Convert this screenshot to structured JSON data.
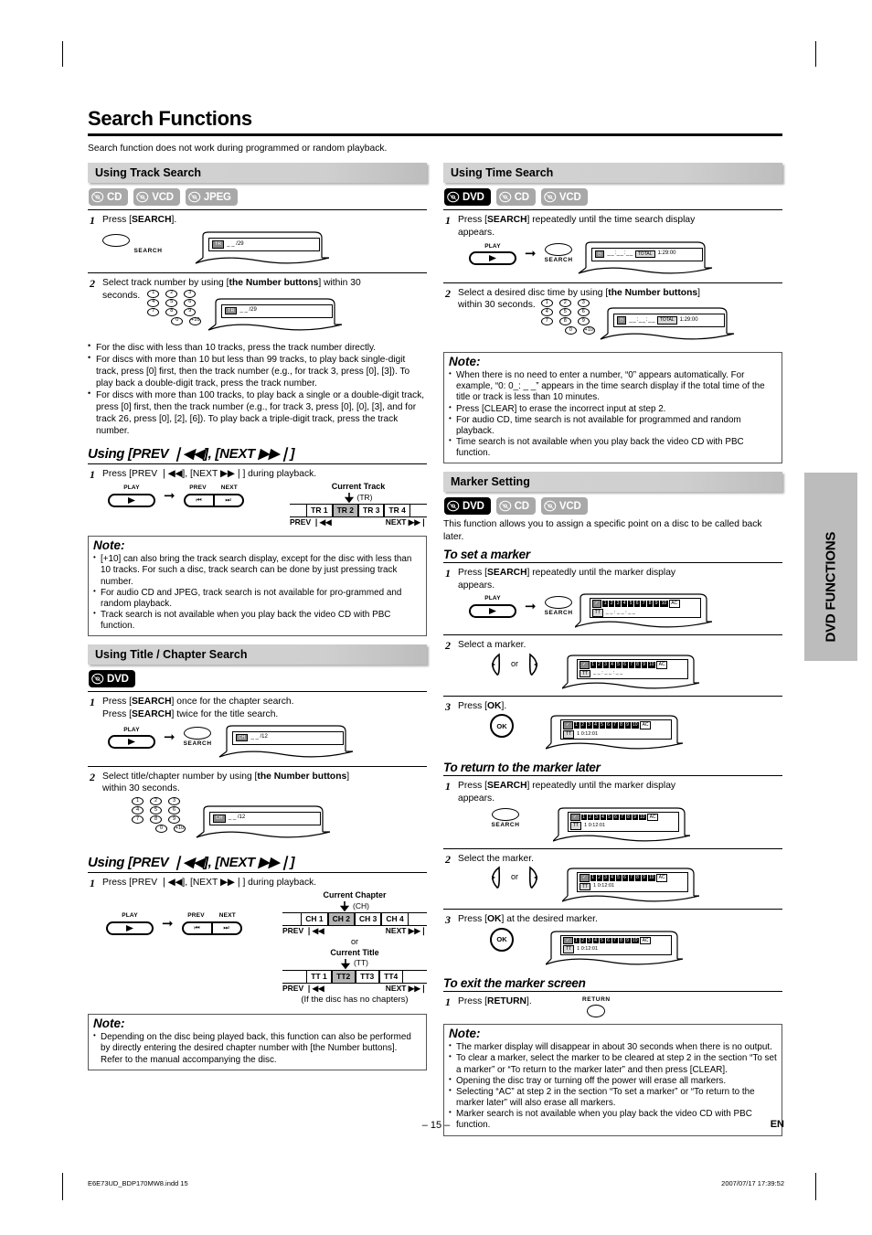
{
  "page": {
    "title": "Search Functions",
    "intro": "Search function does not work during programmed or random playback.",
    "number": "– 15 –",
    "lang_mark": "EN",
    "side_tab": "DVD FUNCTIONS"
  },
  "footer": {
    "file": "E6E73UD_BDP170MW8.indd   15",
    "stamp": "2007/07/17   17:39:52"
  },
  "track_search": {
    "heading": "Using Track Search",
    "badges": [
      {
        "label": "CD",
        "dark": false
      },
      {
        "label": "VCD",
        "dark": false
      },
      {
        "label": "JPEG",
        "dark": false
      }
    ],
    "step1": {
      "num": "1",
      "text_a": "Press [",
      "bold": "SEARCH",
      "text_b": "]."
    },
    "step1_key": {
      "label": "SEARCH"
    },
    "step1_display": {
      "tag": "TR",
      "value": "_ _ /29"
    },
    "step2": {
      "num": "2",
      "line1": "Select track number by using [",
      "bold": "the Number buttons",
      "line1b": "] within 30",
      "line2": "seconds."
    },
    "step2_display": {
      "tag": "TR",
      "value": "_ _ /29"
    },
    "bullets": [
      "For the disc with less than 10 tracks, press the track number directly.",
      "For discs with more than 10 but less than 99 tracks, to play back single-digit track, press [0] first, then the track number (e.g., for track 3, press [0], [3]). To play back a double-digit track, press the track number.",
      "For discs with more than 100 tracks, to play back a single or a double-digit track, press [0] first, then the track number (e.g., for track 3, press [0], [0], [3], and for track 26, press [0], [2], [6]). To play back a triple-digit track, press the track number."
    ]
  },
  "track_prevnext": {
    "heading": "Using [PREV ❘◀◀], [NEXT ▶▶❘]",
    "step1": {
      "num": "1",
      "text": "Press [PREV ❘◀◀], [NEXT ▶▶❘] during playback."
    },
    "keys": {
      "play": "PLAY",
      "prev": "PREV",
      "next": "NEXT"
    },
    "strip": {
      "caption": "Current Track",
      "paren": "(TR)",
      "cells": [
        "TR 1",
        "TR 2",
        "TR 3",
        "TR 4"
      ],
      "active_index": 1,
      "left_label": "PREV ❘◀◀",
      "right_label": "NEXT ▶▶❘"
    },
    "note": {
      "title": "Note:",
      "items": [
        "[+10] can also bring the track search display, except for the disc with less than 10 tracks. For such a disc, track search can be done by just pressing track number.",
        "For audio CD and JPEG, track search is not available for pro-grammed and random playback.",
        "Track search is not available when you play back the video CD with PBC function."
      ]
    }
  },
  "title_chapter": {
    "heading": "Using Title / Chapter Search",
    "badges": [
      {
        "label": "DVD",
        "dark": true
      }
    ],
    "step1": {
      "num": "1",
      "line1": "Press [SEARCH] once for the chapter search.",
      "line2": "Press [SEARCH] twice for the title search."
    },
    "step1_display": {
      "tag": "CH",
      "value": "_ _ /12"
    },
    "step2": {
      "num": "2",
      "line1": "Select title/chapter number by using [the Number buttons]",
      "line2": "within 30 seconds."
    },
    "step2_display": {
      "tag": "CH",
      "value": "_ _ /12"
    }
  },
  "chapter_prevnext": {
    "heading": "Using [PREV ❘◀◀], [NEXT ▶▶❘]",
    "step1": {
      "num": "1",
      "text": "Press [PREV ❘◀◀], [NEXT ▶▶❘] during playback."
    },
    "strip_ch": {
      "caption": "Current Chapter",
      "paren": "(CH)",
      "cells": [
        "CH 1",
        "CH 2",
        "CH 3",
        "CH 4"
      ],
      "active_index": 1,
      "left_label": "PREV ❘◀◀",
      "right_label": "NEXT ▶▶❘"
    },
    "or_word": "or",
    "strip_tt": {
      "caption": "Current Title",
      "paren": "(TT)",
      "cells": [
        "TT 1",
        "TT2",
        "TT3",
        "TT4"
      ],
      "active_index": 1,
      "left_label": "PREV ❘◀◀",
      "right_label": "NEXT ▶▶❘"
    },
    "footnote": "(If the disc has no chapters)",
    "note": {
      "title": "Note:",
      "items": [
        "Depending on the disc being played back, this function can also be performed by directly entering the desired chapter number with [the Number buttons]. Refer to the manual accompanying the disc."
      ]
    }
  },
  "time_search": {
    "heading": "Using Time Search",
    "badges": [
      {
        "label": "DVD",
        "dark": true
      },
      {
        "label": "CD",
        "dark": false
      },
      {
        "label": "VCD",
        "dark": false
      }
    ],
    "step1": {
      "num": "1",
      "line1": "Press [SEARCH] repeatedly until the time search display",
      "line2": "appears."
    },
    "step1_display": {
      "icon": "clock-icon",
      "blank": "_ _ : _ _ : _ _",
      "total": "TOTAL",
      "time": "1:29:00"
    },
    "step2": {
      "num": "2",
      "line1": "Select a desired disc time by using [the Number buttons]",
      "line2": "within 30 seconds."
    },
    "step2_display": {
      "icon": "clock-icon",
      "blank": "_ _ : _ _ : _ _",
      "total": "TOTAL",
      "time": "1:29:00"
    },
    "note": {
      "title": "Note:",
      "items": [
        "When there is no need to enter a number, “0” appears automatically. For example, “0: 0_: _ _” appears in the time search display if the total time of the title or track is less than 10 minutes.",
        "Press [CLEAR] to erase the incorrect input at step 2.",
        "For audio CD, time search is not available for programmed and random playback.",
        "Time search is not available when you play back the video CD with PBC function."
      ]
    }
  },
  "marker": {
    "heading": "Marker Setting",
    "badges": [
      {
        "label": "DVD",
        "dark": true
      },
      {
        "label": "CD",
        "dark": false
      },
      {
        "label": "VCD",
        "dark": false
      }
    ],
    "intro": "This function allows you to assign a specific point on a disc to be called back later.",
    "set": {
      "heading": "To set a marker",
      "steps": [
        {
          "num": "1",
          "line1": "Press [SEARCH] repeatedly until the marker display",
          "line2": "appears."
        },
        {
          "num": "2",
          "line1": "Select a marker.",
          "line2": ""
        },
        {
          "num": "3",
          "line1": "Press [OK].",
          "line2": ""
        }
      ],
      "display_segments": [
        "1",
        "2",
        "3",
        "4",
        "5",
        "6",
        "7",
        "8",
        "9",
        "10"
      ],
      "display_ac": "AC",
      "display_tt_tag": "TT",
      "display_time_blank": "_ _ : _ _ : _ _",
      "display_time_set": "1  0:12:01"
    },
    "ret": {
      "heading": "To return to the marker later",
      "steps": [
        {
          "num": "1",
          "line1": "Press [SEARCH] repeatedly until the marker display",
          "line2": "appears."
        },
        {
          "num": "2",
          "line1": "Select the marker.",
          "line2": ""
        },
        {
          "num": "3",
          "line1": "Press [OK] at the desired marker.",
          "line2": ""
        }
      ]
    },
    "exit": {
      "heading": "To exit the marker screen",
      "step": {
        "num": "1",
        "text": "Press [RETURN]."
      },
      "key_label": "RETURN"
    },
    "or_word": "or",
    "ok_label": "OK",
    "search_label": "SEARCH",
    "play_label": "PLAY",
    "note": {
      "title": "Note:",
      "items": [
        "The marker display will disappear in about 30 seconds when there is no output.",
        "To clear a marker, select the marker to be cleared at step 2 in the section “To set a marker” or “To return to the marker later” and then press [CLEAR].",
        "Opening the disc tray or turning off the power will erase all markers.",
        "Selecting “AC” at step 2 in the section “To set a marker” or “To return to the marker later” will also erase all markers.",
        "Marker search is not available when you play back the video CD with PBC function."
      ]
    }
  },
  "numpad": {
    "rows": [
      [
        "1",
        "2",
        "3"
      ],
      [
        "4",
        "5",
        "6"
      ],
      [
        "7",
        "8",
        "9"
      ],
      [
        "0",
        "+10"
      ]
    ]
  },
  "colors": {
    "section_bar": "#d0d0d0",
    "badge_gray": "#a8a8a8",
    "badge_dark": "#000000",
    "active_cell": "#b5b5b5",
    "side_tab": "#bcbcbc"
  }
}
